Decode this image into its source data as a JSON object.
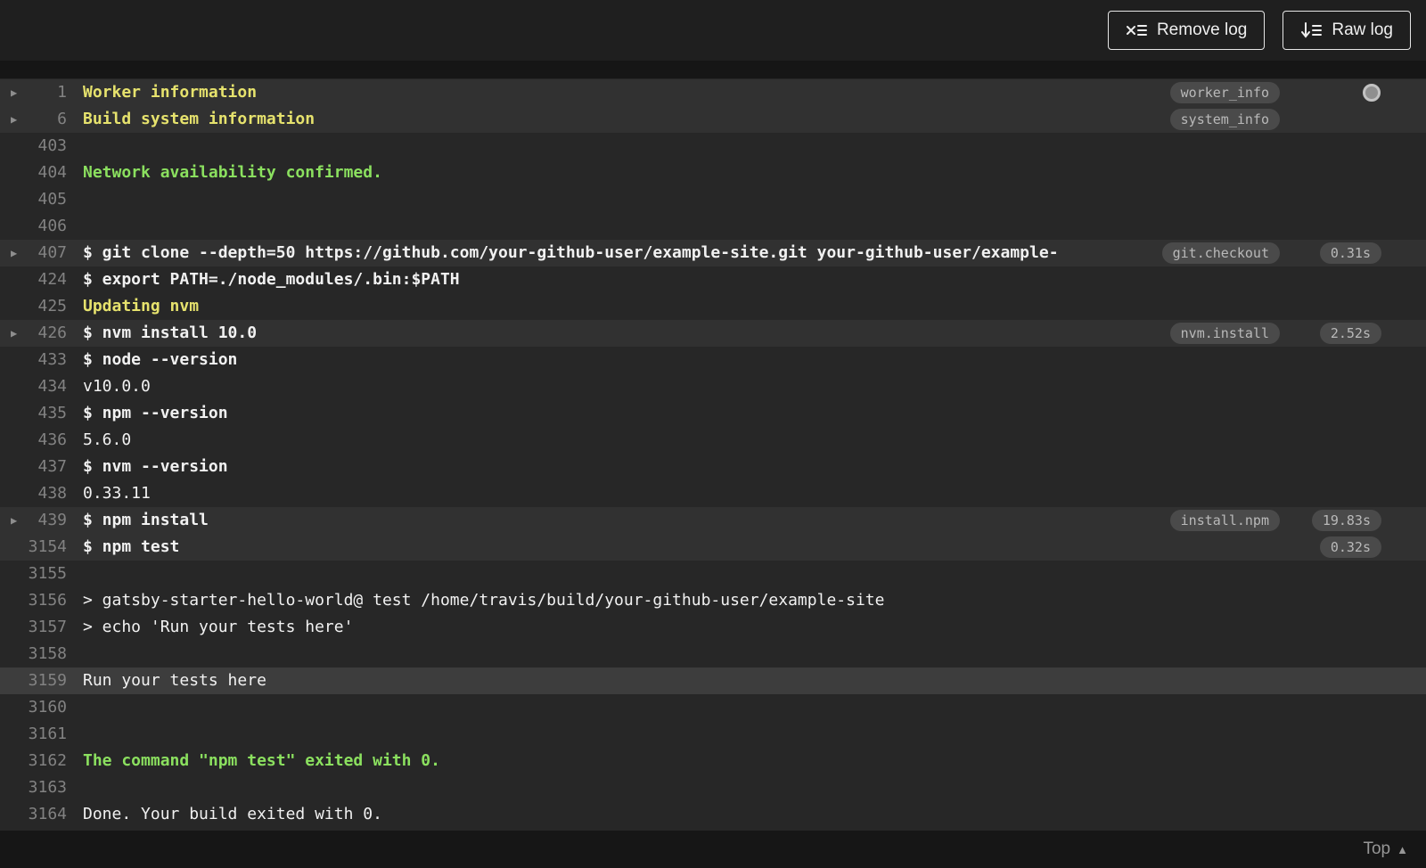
{
  "header": {
    "buttons": [
      {
        "label": "Remove log",
        "icon": "remove-log-icon"
      },
      {
        "label": "Raw log",
        "icon": "raw-log-icon"
      }
    ]
  },
  "footer": {
    "top_label": "Top"
  },
  "colors": {
    "toolbar_bg": "#1f1f1f",
    "log_bg": "#272727",
    "section_row_bg": "#313131",
    "selected_row_bg": "#3d3d3d",
    "text": "#f1f1f1",
    "line_number": "#828282",
    "yellow": "#e6e26d",
    "green": "#8be05f",
    "badge_bg": "#4a4a4a",
    "badge_text": "#b9b9b9"
  },
  "log": {
    "lines": [
      {
        "num": "1",
        "text": "Worker information",
        "style": "yellow",
        "fold": true,
        "badge": "worker_info",
        "row": "section",
        "indicator": true
      },
      {
        "num": "6",
        "text": "Build system information",
        "style": "yellow",
        "fold": true,
        "badge": "system_info",
        "row": "section"
      },
      {
        "num": "403",
        "text": "",
        "style": "plain"
      },
      {
        "num": "404",
        "text": "Network availability confirmed.",
        "style": "green"
      },
      {
        "num": "405",
        "text": "",
        "style": "plain"
      },
      {
        "num": "406",
        "text": "",
        "style": "plain"
      },
      {
        "num": "407",
        "text": "$ git clone --depth=50 https://github.com/your-github-user/example-site.git your-github-user/example-",
        "style": "cmd",
        "fold": true,
        "badge": "git.checkout",
        "time": "0.31s",
        "row": "section"
      },
      {
        "num": "424",
        "text": "$ export PATH=./node_modules/.bin:$PATH",
        "style": "cmd"
      },
      {
        "num": "425",
        "text": "Updating nvm",
        "style": "yellow"
      },
      {
        "num": "426",
        "text": "$ nvm install 10.0",
        "style": "cmd",
        "fold": true,
        "badge": "nvm.install",
        "time": "2.52s",
        "row": "section"
      },
      {
        "num": "433",
        "text": "$ node --version",
        "style": "cmd"
      },
      {
        "num": "434",
        "text": "v10.0.0",
        "style": "plain"
      },
      {
        "num": "435",
        "text": "$ npm --version",
        "style": "cmd"
      },
      {
        "num": "436",
        "text": "5.6.0",
        "style": "plain"
      },
      {
        "num": "437",
        "text": "$ nvm --version",
        "style": "cmd"
      },
      {
        "num": "438",
        "text": "0.33.11",
        "style": "plain"
      },
      {
        "num": "439",
        "text": "$ npm install",
        "style": "cmd",
        "fold": true,
        "badge": "install.npm",
        "time": "19.83s",
        "row": "section"
      },
      {
        "num": "3154",
        "text": "$ npm test",
        "style": "cmd",
        "time": "0.32s",
        "row": "section"
      },
      {
        "num": "3155",
        "text": "",
        "style": "plain"
      },
      {
        "num": "3156",
        "text": "> gatsby-starter-hello-world@ test /home/travis/build/your-github-user/example-site",
        "style": "plain"
      },
      {
        "num": "3157",
        "text": "> echo 'Run your tests here'",
        "style": "plain"
      },
      {
        "num": "3158",
        "text": "",
        "style": "plain"
      },
      {
        "num": "3159",
        "text": "Run your tests here",
        "style": "plain",
        "row": "selected"
      },
      {
        "num": "3160",
        "text": "",
        "style": "plain"
      },
      {
        "num": "3161",
        "text": "",
        "style": "plain"
      },
      {
        "num": "3162",
        "text": "The command \"npm test\" exited with 0.",
        "style": "green"
      },
      {
        "num": "3163",
        "text": "",
        "style": "plain"
      },
      {
        "num": "3164",
        "text": "Done. Your build exited with 0.",
        "style": "plain"
      }
    ]
  }
}
